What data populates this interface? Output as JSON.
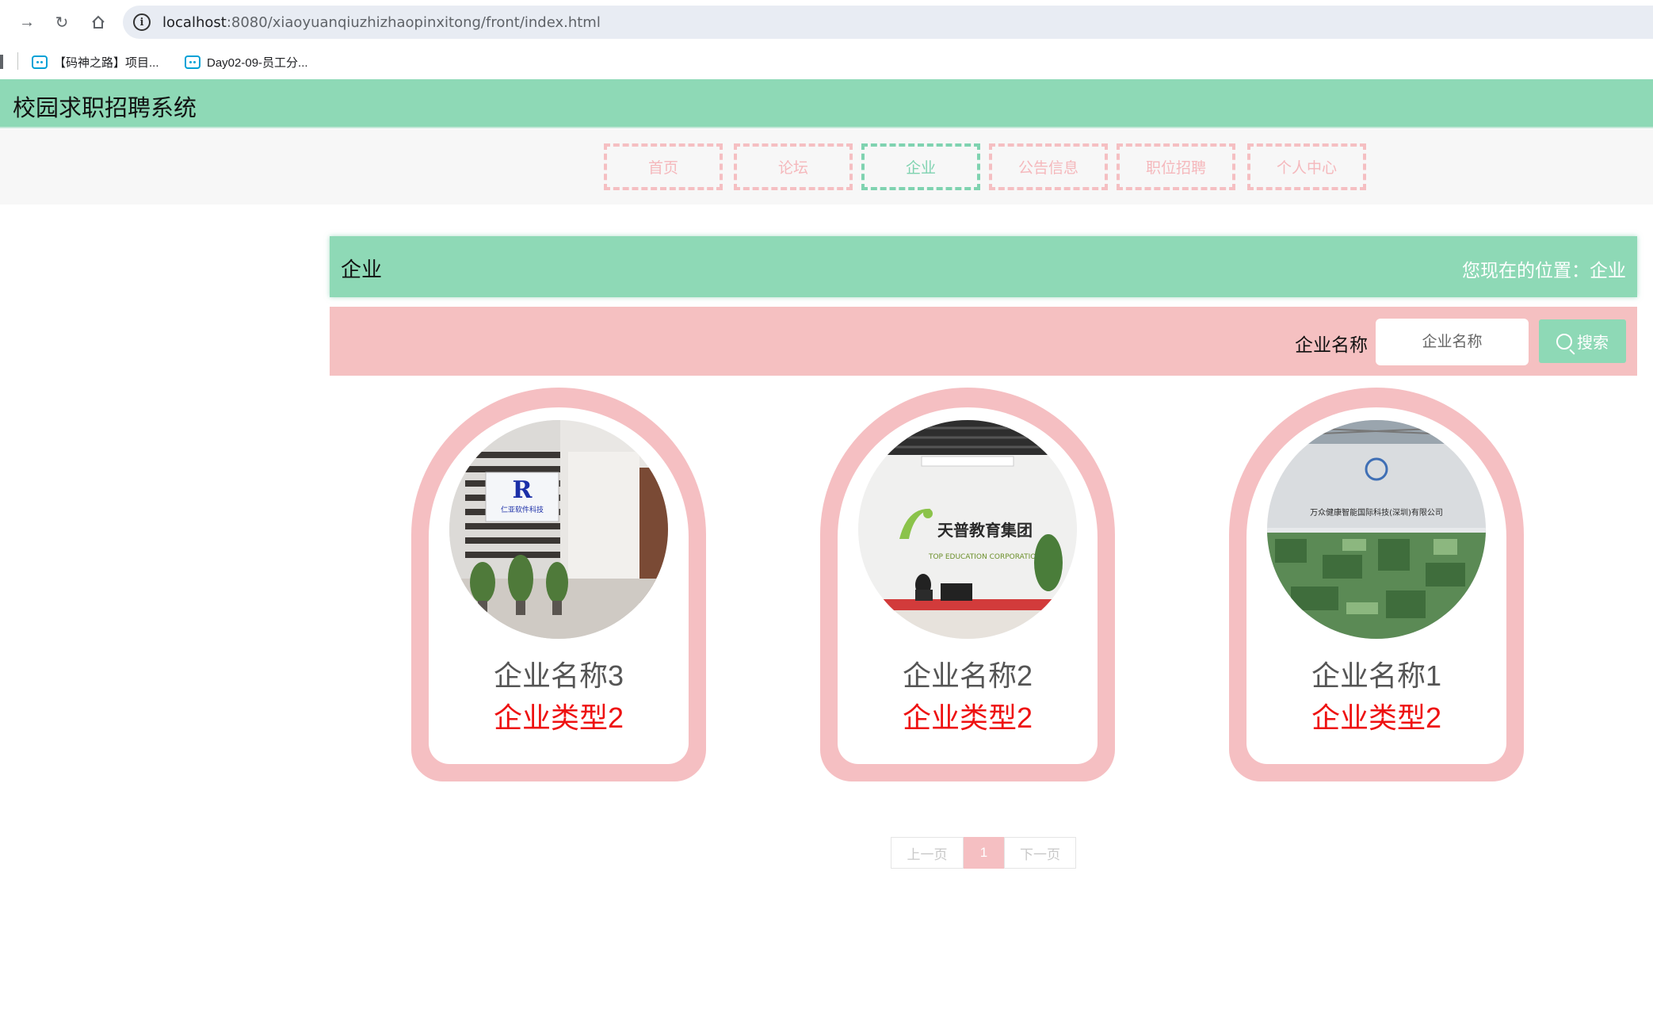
{
  "browser": {
    "url_host": "localhost",
    "url_path": ":8080/xiaoyuanqiuzhizhaopinxitong/front/index.html",
    "bookmarks": [
      "【码神之路】项目...",
      "Day02-09-员工分..."
    ]
  },
  "app": {
    "title": "校园求职招聘系统"
  },
  "nav": {
    "items": [
      {
        "label": "首页"
      },
      {
        "label": "论坛"
      },
      {
        "label": "企业"
      },
      {
        "label": "公告信息"
      },
      {
        "label": "职位招聘"
      },
      {
        "label": "个人中心"
      }
    ],
    "active_index": 2
  },
  "breadcrumb": {
    "title": "企业",
    "location": "您现在的位置：企业"
  },
  "search": {
    "label": "企业名称",
    "placeholder": "企业名称",
    "button_label": "搜索"
  },
  "companies": [
    {
      "name": "企业名称3",
      "type": "企业类型2",
      "image": "office-lobby-logo-wall"
    },
    {
      "name": "企业名称2",
      "type": "企业类型2",
      "image": "reception-desk-education-group"
    },
    {
      "name": "企业名称1",
      "type": "企业类型2",
      "image": "green-reception-desk-health"
    }
  ],
  "image_signage": [
    "仁亚软件科技",
    "天普教育集团",
    "TOP EDUCATION CORPORATION",
    "万众健康智能国际科技(深圳)有限公司"
  ],
  "pagination": {
    "prev_label": "上一页",
    "current": "1",
    "next_label": "下一页"
  },
  "colors": {
    "accent_green": "#8ed9b6",
    "accent_pink": "#f5bfc2",
    "type_red": "#ee1111"
  }
}
